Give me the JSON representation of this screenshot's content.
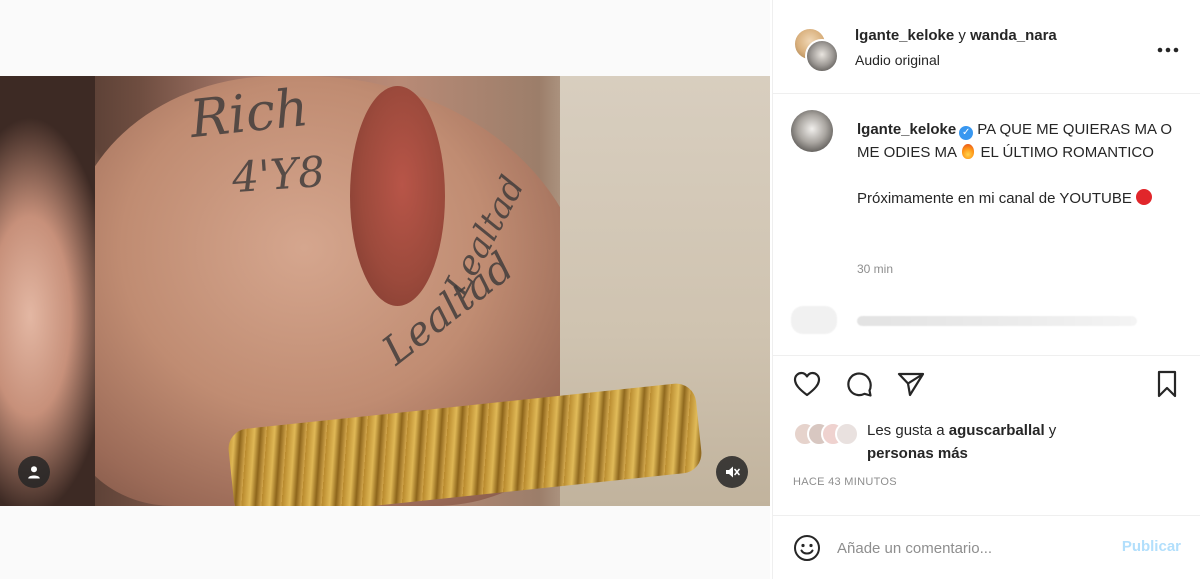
{
  "header": {
    "user_1": "lgante_keloke",
    "conjunction": " y ",
    "user_2": "wanda_nara",
    "audio_label": "Audio original",
    "more_icon": "more-horizontal-icon"
  },
  "media": {
    "tattoo_1": "Rich",
    "tattoo_2": "4'Y8",
    "tattoo_3": "Lealtad",
    "tattoo_4": "Lealtad",
    "user_tag_icon": "user-tag-icon",
    "mute_icon": "speaker-muted-icon"
  },
  "caption": {
    "username": "lgante_keloke",
    "verified_icon": "verified-badge-icon",
    "line_1_part_1": "PA QUE ME QUIERAS MA O ME ODIES MA",
    "fire_icon": "fire-emoji",
    "line_1_part_2": "EL ÚLTIMO ROMANTICO",
    "line_2": "Próximamente en mi canal de YOUTUBE",
    "red_circle_icon": "red-circle-emoji",
    "time": "30 min"
  },
  "actions": {
    "like_icon": "heart-icon",
    "comment_icon": "comment-bubble-icon",
    "share_icon": "paper-plane-icon",
    "save_icon": "bookmark-icon"
  },
  "likes": {
    "prefix": "Les gusta a ",
    "user": "aguscarballal",
    "middle": " y ",
    "suffix": "personas más"
  },
  "posted_ago": "HACE 43 MINUTOS",
  "comment_box": {
    "emoji_icon": "smiley-icon",
    "placeholder": "Añade un comentario...",
    "publish_label": "Publicar"
  },
  "colors": {
    "accent_disabled": "#b2dffc",
    "verified_blue": "#3897f0",
    "secondary_text": "#8e8e8e",
    "primary_text": "#262626"
  }
}
